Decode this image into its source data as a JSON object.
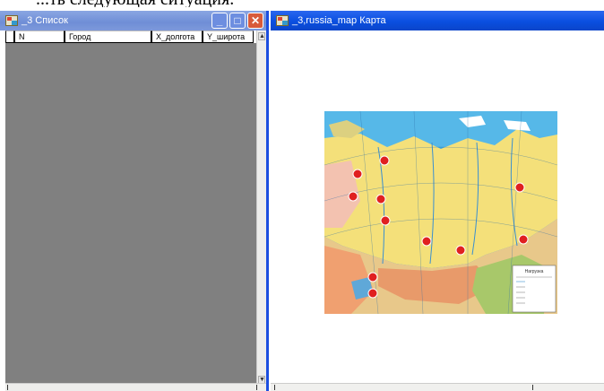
{
  "list_window": {
    "title": "_3 Список",
    "columns": [
      "N",
      "Город",
      "X_долгота",
      "Y_широта"
    ]
  },
  "map_window": {
    "title": "_3,russia_map Карта",
    "legend_title": "Нагрузка"
  },
  "colors": {
    "active_title": "#0a4fe0",
    "inactive_title": "#7d99db",
    "list_background": "#808080"
  }
}
